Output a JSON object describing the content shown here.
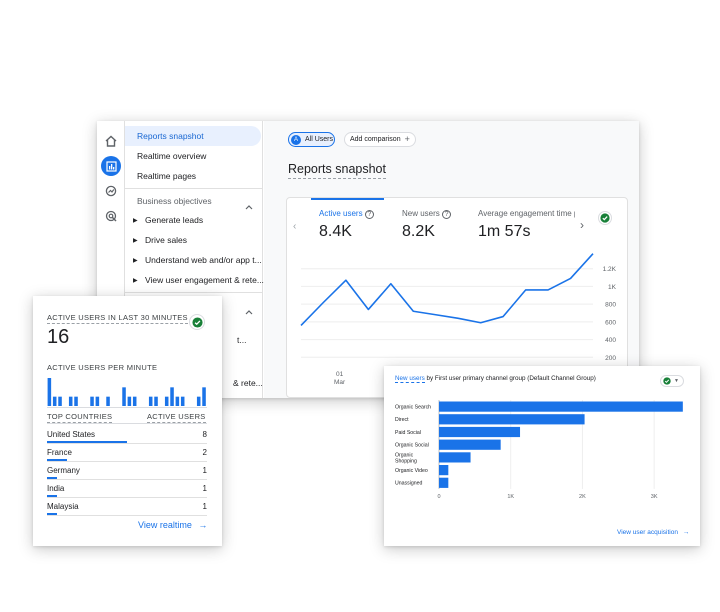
{
  "main": {
    "nav": {
      "items": [
        "Reports snapshot",
        "Realtime overview",
        "Realtime pages"
      ],
      "section": "Business objectives",
      "sub_items": [
        "Generate leads",
        "Drive sales",
        "Understand web and/or app t...",
        "View user engagement & rete..."
      ],
      "partial_items": [
        "t...",
        "& rete..."
      ]
    },
    "chips": {
      "segment_letter": "A",
      "segment": "All Users",
      "add": "Add comparison",
      "add_icon": "+"
    },
    "title": "Reports snapshot",
    "kpis": [
      {
        "label": "Active users",
        "value": "8.4K"
      },
      {
        "label": "New users",
        "value": "8.2K"
      },
      {
        "label": "Average engagement time p",
        "value": "1m 57s"
      }
    ],
    "chart_data": {
      "type": "line",
      "series": [
        {
          "values": [
            560,
            820,
            1070,
            740,
            1030,
            720,
            680,
            640,
            590,
            660,
            960,
            960,
            1090,
            1370
          ]
        }
      ],
      "ylim": [
        0,
        1400
      ],
      "yticks": [
        "1.2K",
        "1K",
        "800",
        "600",
        "400",
        "200"
      ],
      "xtick_day": "01",
      "xtick_month": "Mar"
    }
  },
  "realtime": {
    "title": "ACTIVE USERS IN LAST 30 MINUTES",
    "count": "16",
    "per_minute_label": "ACTIVE USERS PER MINUTE",
    "per_minute_values": [
      3,
      1,
      1,
      0,
      1,
      1,
      0,
      0,
      1,
      1,
      0,
      1,
      0,
      0,
      2,
      1,
      1,
      0,
      0,
      1,
      1,
      0,
      1,
      2,
      1,
      1,
      0,
      0,
      1,
      2
    ],
    "top_countries_label": "TOP COUNTRIES",
    "active_users_label": "ACTIVE USERS",
    "countries": [
      {
        "name": "United States",
        "value": "8"
      },
      {
        "name": "France",
        "value": "2"
      },
      {
        "name": "Germany",
        "value": "1"
      },
      {
        "name": "India",
        "value": "1"
      },
      {
        "name": "Malaysia",
        "value": "1"
      }
    ],
    "link": "View realtime",
    "link_icon": "→"
  },
  "acquisition": {
    "title_metric": "New users",
    "title_rest": " by First user primary channel group (Default Channel Group)",
    "link": "View user acquisition",
    "link_icon": "→",
    "chart_data": {
      "type": "bar",
      "categories": [
        "Organic Search",
        "Direct",
        "Paid Social",
        "Organic Social",
        "Organic Shopping",
        "Organic Video",
        "Unassigned"
      ],
      "values": [
        3400,
        2030,
        1130,
        860,
        440,
        130,
        130
      ],
      "xlim": [
        0,
        3500
      ],
      "xticks": [
        "0",
        "1K",
        "2K",
        "3K"
      ]
    }
  },
  "colors": {
    "accent": "#1a73e8",
    "check": "#188038"
  }
}
